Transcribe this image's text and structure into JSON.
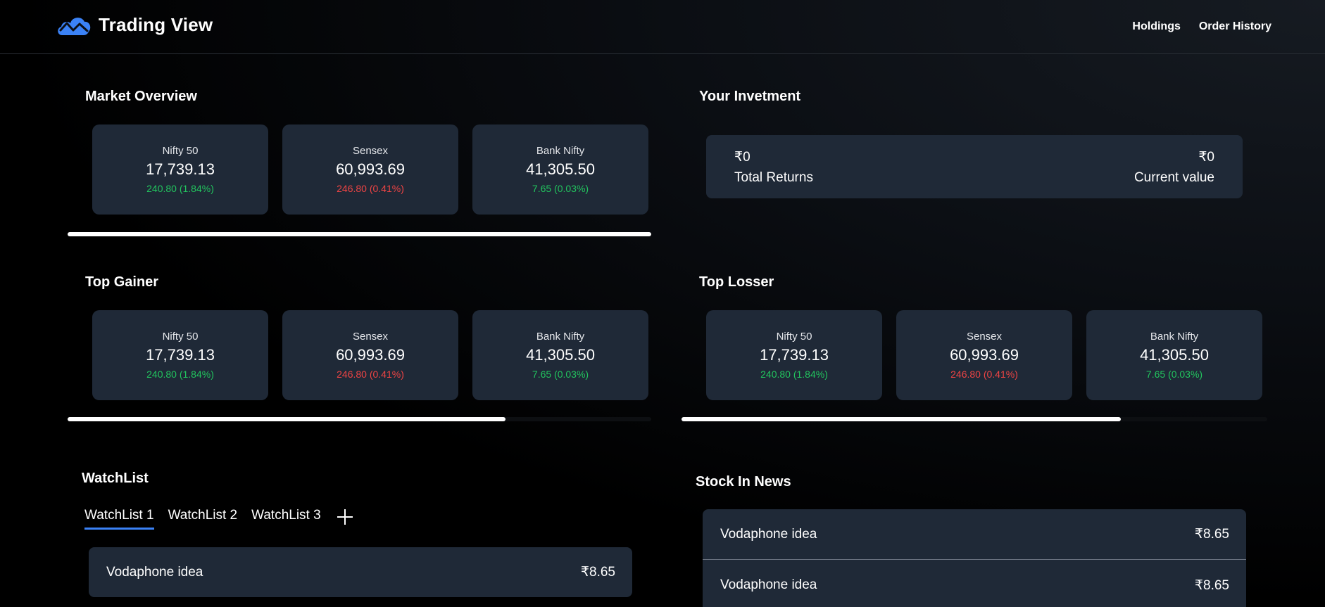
{
  "header": {
    "title": "Trading View",
    "logo_icon": "chart-cloud-icon",
    "nav": [
      "Holdings",
      "Order History"
    ]
  },
  "market_overview": {
    "title": "Market Overview",
    "cards": [
      {
        "name": "Nifty 50",
        "value": "17,739.13",
        "change": "240.80 (1.84%)",
        "trend": "up"
      },
      {
        "name": "Sensex",
        "value": "60,993.69",
        "change": "246.80 (0.41%)",
        "trend": "down"
      },
      {
        "name": "Bank Nifty",
        "value": "41,305.50",
        "change": "7.65 (0.03%)",
        "trend": "up"
      }
    ],
    "scroll_fraction": 1.0
  },
  "investment": {
    "title": "Your Invetment",
    "total_returns_amount": "₹0",
    "total_returns_label": "Total Returns",
    "current_value_amount": "₹0",
    "current_value_label": "Current value"
  },
  "top_gainer": {
    "title": "Top Gainer",
    "cards": [
      {
        "name": "Nifty 50",
        "value": "17,739.13",
        "change": "240.80 (1.84%)",
        "trend": "up"
      },
      {
        "name": "Sensex",
        "value": "60,993.69",
        "change": "246.80 (0.41%)",
        "trend": "down"
      },
      {
        "name": "Bank Nifty",
        "value": "41,305.50",
        "change": "7.65 (0.03%)",
        "trend": "up"
      }
    ],
    "scroll_fraction": 0.75
  },
  "top_loser": {
    "title": "Top Losser",
    "cards": [
      {
        "name": "Nifty 50",
        "value": "17,739.13",
        "change": "240.80 (1.84%)",
        "trend": "up"
      },
      {
        "name": "Sensex",
        "value": "60,993.69",
        "change": "246.80 (0.41%)",
        "trend": "down"
      },
      {
        "name": "Bank Nifty",
        "value": "41,305.50",
        "change": "7.65 (0.03%)",
        "trend": "up"
      }
    ],
    "scroll_fraction": 0.75
  },
  "watchlist": {
    "title": "WatchList",
    "tabs": [
      "WatchList 1",
      "WatchList 2",
      "WatchList 3"
    ],
    "active_tab": "WatchList 1",
    "items": [
      {
        "name": "Vodaphone idea",
        "price": "₹8.65"
      }
    ]
  },
  "news": {
    "title": "Stock In News",
    "items": [
      {
        "name": "Vodaphone idea",
        "price": "₹8.65"
      },
      {
        "name": "Vodaphone idea",
        "price": "₹8.65"
      }
    ]
  },
  "colors": {
    "up": "#22c55e",
    "down": "#ef4444",
    "card_bg": "#1f2937",
    "accent": "#3b82f6"
  }
}
